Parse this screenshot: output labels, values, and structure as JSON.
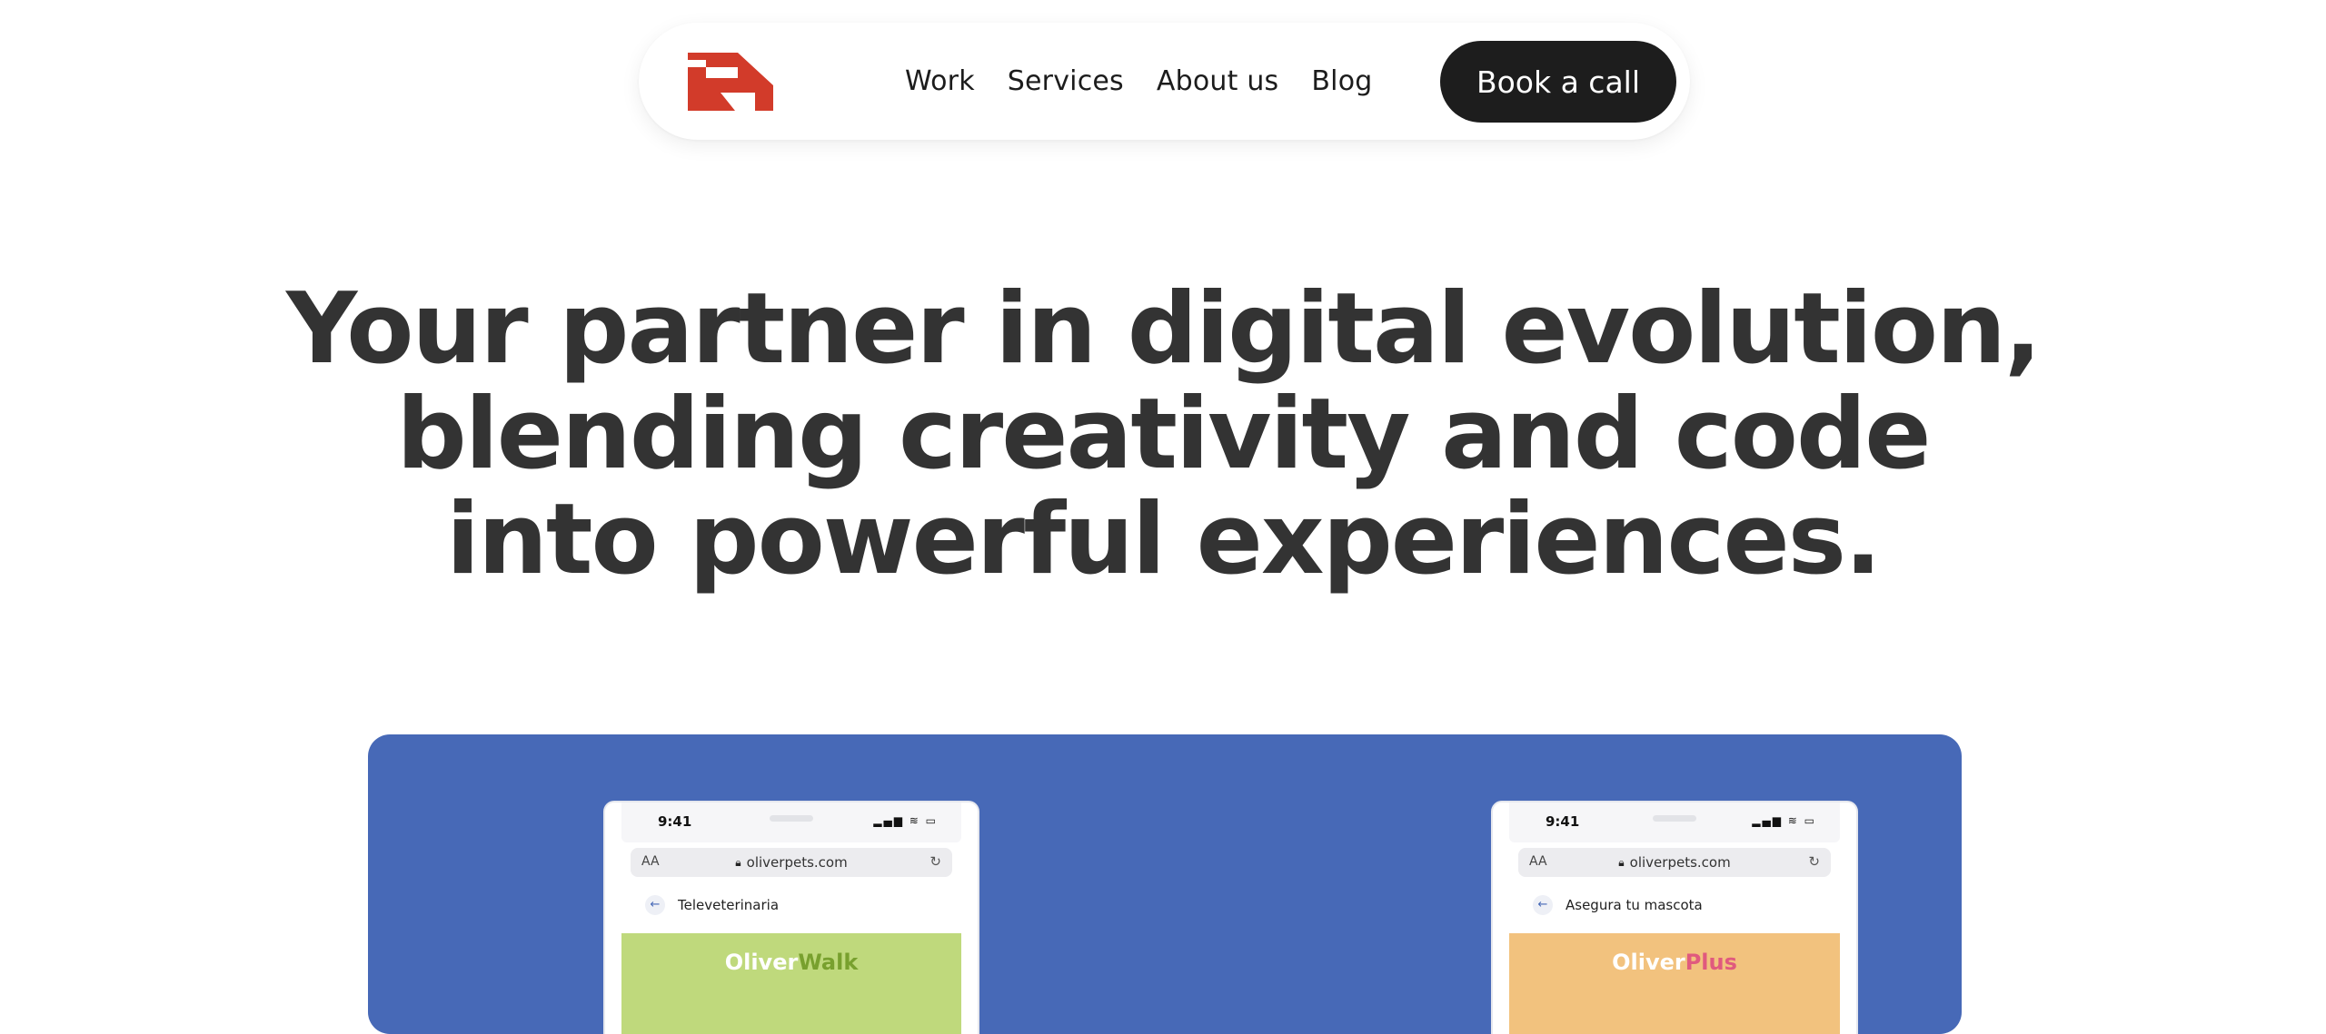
{
  "nav": {
    "logo": "agency-logo",
    "links": [
      "Work",
      "Services",
      "About us",
      "Blog"
    ],
    "cta_label": "Book a call"
  },
  "hero": {
    "lines": [
      "Your partner in digital evolution,",
      "blending creativity and code",
      "into powerful experiences."
    ]
  },
  "showcase": {
    "background_color": "#4769b7",
    "phones": [
      {
        "time": "9:41",
        "text_size_label": "AA",
        "url": "oliverpets.com",
        "page_title": "Televeterinaria",
        "brand_main": "Oliver",
        "brand_suffix": "Walk",
        "banner_color": "#bfd97c"
      },
      {
        "time": "9:41",
        "text_size_label": "AA",
        "url": "oliverpets.com",
        "page_title": "Asegura tu mascota",
        "brand_main": "Oliver",
        "brand_suffix": "Plus",
        "banner_color": "#f2c27e"
      }
    ]
  },
  "colors": {
    "logo_red": "#d23b2a",
    "cta_bg": "#1d1d1d",
    "heading": "#333333"
  }
}
